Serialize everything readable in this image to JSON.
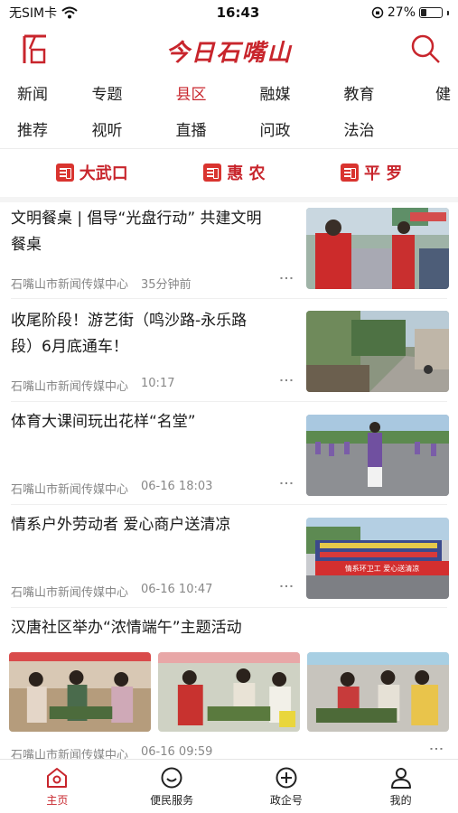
{
  "status_bar": {
    "carrier": "无SIM卡",
    "time": "16:43",
    "battery": "27%",
    "battery_level": 0.27
  },
  "header": {
    "title": "今日石嘴山"
  },
  "channels": {
    "row1": [
      "新闻",
      "专题",
      "县区",
      "融媒",
      "教育",
      "健"
    ],
    "row2": [
      "推荐",
      "视听",
      "直播",
      "问政",
      "法治"
    ],
    "active": "县区"
  },
  "districts": [
    "大武口",
    "惠 农",
    "平 罗"
  ],
  "news": [
    {
      "title_lines": [
        "文明餐桌 | 倡导“光盘行动” 共建文明",
        "餐桌"
      ],
      "source": "石嘴山市新闻传媒中心",
      "time": "35分钟前"
    },
    {
      "title_lines": [
        "收尾阶段！游艺街（鸣沙路-永乐路",
        "段）6月底通车！"
      ],
      "source": "石嘴山市新闻传媒中心",
      "time": "10:17"
    },
    {
      "title_lines": [
        "体育大课间玩出花样“名堂”"
      ],
      "source": "石嘴山市新闻传媒中心",
      "time": "06-16 18:03"
    },
    {
      "title_lines": [
        "情系户外劳动者 爱心商户送清凉"
      ],
      "source": "石嘴山市新闻传媒中心",
      "time": "06-16 10:47",
      "banner_text": "情系环卫工 爱心送清凉"
    },
    {
      "title_lines": [
        "汉唐社区举办“浓情端午”主题活动"
      ],
      "source": "石嘴山市新闻传媒中心",
      "time": "06-16 09:59"
    }
  ],
  "tabs": [
    {
      "label": "主页",
      "icon": "home-icon"
    },
    {
      "label": "便民服务",
      "icon": "service-icon"
    },
    {
      "label": "政企号",
      "icon": "plus-circle-icon"
    },
    {
      "label": "我的",
      "icon": "user-icon"
    }
  ],
  "colors": {
    "accent": "#c8252c"
  }
}
